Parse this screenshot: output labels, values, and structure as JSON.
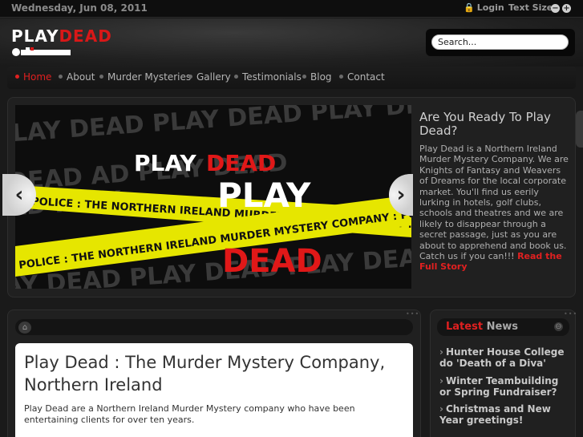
{
  "topbar": {
    "date": "Wednesday, Jun 08, 2011",
    "login_label": "Login",
    "text_size_label": "Text Size",
    "decrease_symbol": "−",
    "increase_symbol": "+"
  },
  "brand": {
    "logo_play": "PLAY",
    "logo_dead": "DEAD"
  },
  "search": {
    "value": "Search..."
  },
  "nav": {
    "items": [
      "Home",
      "About",
      "Murder Mysteries",
      "Gallery",
      "Testimonials",
      "Blog",
      "Contact"
    ],
    "active_index": 0
  },
  "slider": {
    "banner_word_1": "PLAY",
    "banner_word_2": "DEAD",
    "tape_text": "POLICE : THE NORTHERN IRELAND MURDER MYSTERY COMPANY : POLICE",
    "prev_symbol": "‹",
    "next_symbol": "›"
  },
  "hero": {
    "title": "Are You Ready To Play Dead?",
    "body": "Play Dead is a Northern Ireland Murder Mystery Company. We are Knights of Fantasy and Weavers of Dreams for the local corporate market.  You'll find us eerily lurking in hotels, golf clubs, schools and theatres and we are likely to disappear through a secret passage, just as you are about to apprehend and book us. Catch us if you can!!!",
    "more_link": "Read the Full Story"
  },
  "article": {
    "title": "Play Dead : The Murder Mystery Company, Northern Ireland",
    "paragraph_1": "Play Dead are a Northern Ireland Murder Mystery company who have been entertaining clients for over ten years."
  },
  "news": {
    "title_highlight": "Latest",
    "title_rest": "News",
    "items": [
      "Hunter House College do 'Death of a Diva'",
      "Winter Teambuilding or Spring Fundraiser?",
      "Christmas and New Year greetings!"
    ]
  },
  "colors": {
    "accent": "#e02020",
    "tape": "#e6e600",
    "background": "#1a1a1a"
  }
}
